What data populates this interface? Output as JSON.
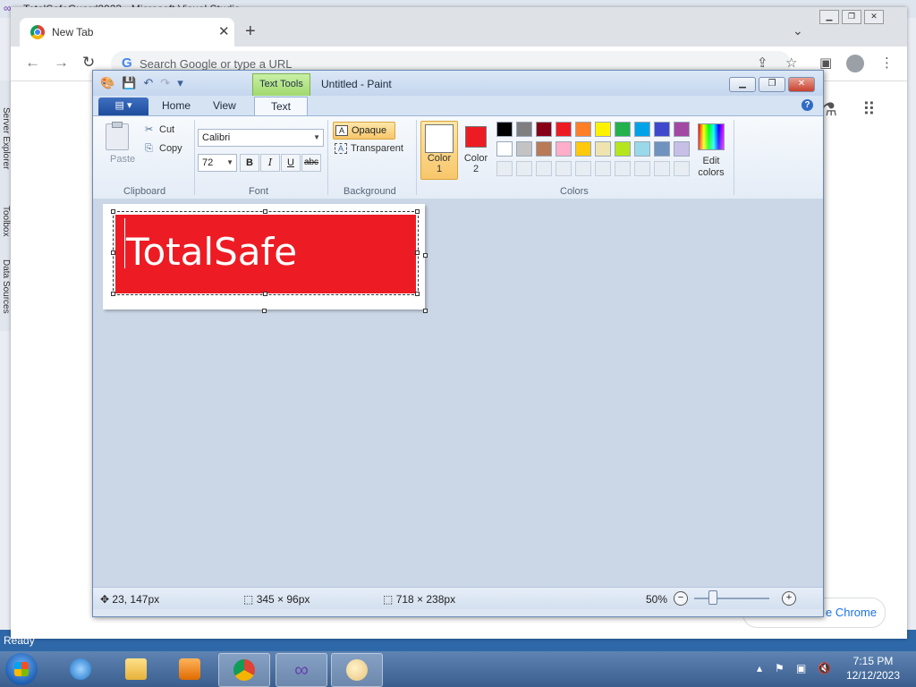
{
  "vs": {
    "title": "TotalSafeGuard2023 - Microsoft Visual Studio",
    "side_labels": [
      "Server Explorer",
      "Toolbox",
      "Data Sources"
    ],
    "status": "Ready"
  },
  "chrome": {
    "tab_title": "New Tab",
    "omnibox_placeholder": "Search Google or type a URL",
    "customize_label": "e Chrome"
  },
  "paint": {
    "title": "Untitled - Paint",
    "contextual_tab": "Text Tools",
    "tabs": [
      "Home",
      "View",
      "Text"
    ],
    "active_tab": "Text",
    "clipboard": {
      "paste": "Paste",
      "cut": "Cut",
      "copy": "Copy",
      "label": "Clipboard"
    },
    "font": {
      "family": "Calibri",
      "size": "72",
      "label": "Font",
      "bold": "B",
      "italic": "I",
      "underline": "U",
      "strike": "abc"
    },
    "background": {
      "opaque": "Opaque",
      "transparent": "Transparent",
      "label": "Background"
    },
    "colors": {
      "color1_label1": "Color",
      "color1_label2": "1",
      "color2_label1": "Color",
      "color2_label2": "2",
      "color1": "#ffffff",
      "color2": "#ed1c24",
      "edit_label1": "Edit",
      "edit_label2": "colors",
      "label": "Colors",
      "palette_row1": [
        "#000000",
        "#7f7f7f",
        "#880015",
        "#ed1c24",
        "#ff7f27",
        "#fff200",
        "#22b14c",
        "#00a2e8",
        "#3f48cc",
        "#a349a4"
      ],
      "palette_row2": [
        "#ffffff",
        "#c3c3c3",
        "#b97a57",
        "#ffaec9",
        "#ffc90e",
        "#efe4b0",
        "#b5e61d",
        "#99d9ea",
        "#7092be",
        "#c8bfe7"
      ]
    },
    "canvas_text": "TotalSafe",
    "status": {
      "cursor": "23, 147px",
      "selection": "345 × 96px",
      "image_size": "718 × 238px",
      "zoom": "50%"
    }
  },
  "taskbar": {
    "time": "7:15 PM",
    "date": "12/12/2023"
  }
}
